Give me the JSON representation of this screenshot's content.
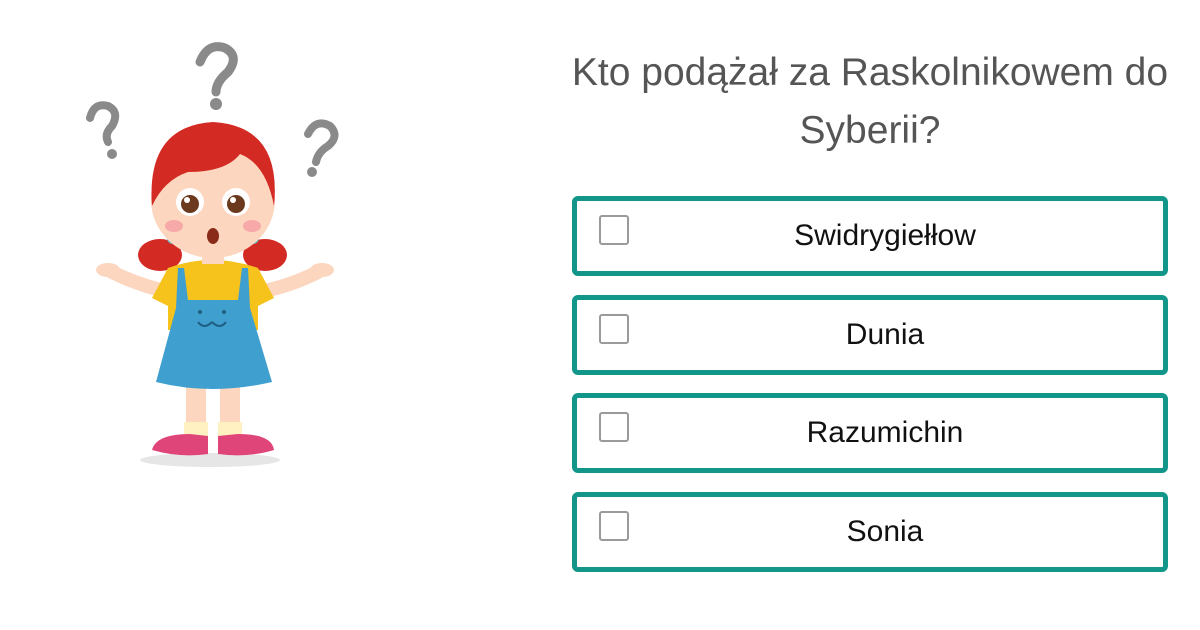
{
  "question": {
    "text": "Kto podążał za Raskolnikowem do Syberii?"
  },
  "options": [
    {
      "label": "Swidrygiełłow",
      "checked": false
    },
    {
      "label": "Dunia",
      "checked": false
    },
    {
      "label": "Razumichin",
      "checked": false
    },
    {
      "label": "Sonia",
      "checked": false
    }
  ],
  "colors": {
    "option_border": "#12968a",
    "question_text": "#555555",
    "checkbox_border": "#9a9a9a",
    "hair": "#d42a24",
    "shirt": "#f6c21c",
    "dress": "#3f9fcf",
    "shoes": "#e0457a",
    "question_marks": "#8a8a8a"
  },
  "illustration": {
    "subject": "confused-girl-illustration",
    "icons": [
      "question-mark-icon",
      "question-mark-icon",
      "question-mark-icon"
    ]
  }
}
